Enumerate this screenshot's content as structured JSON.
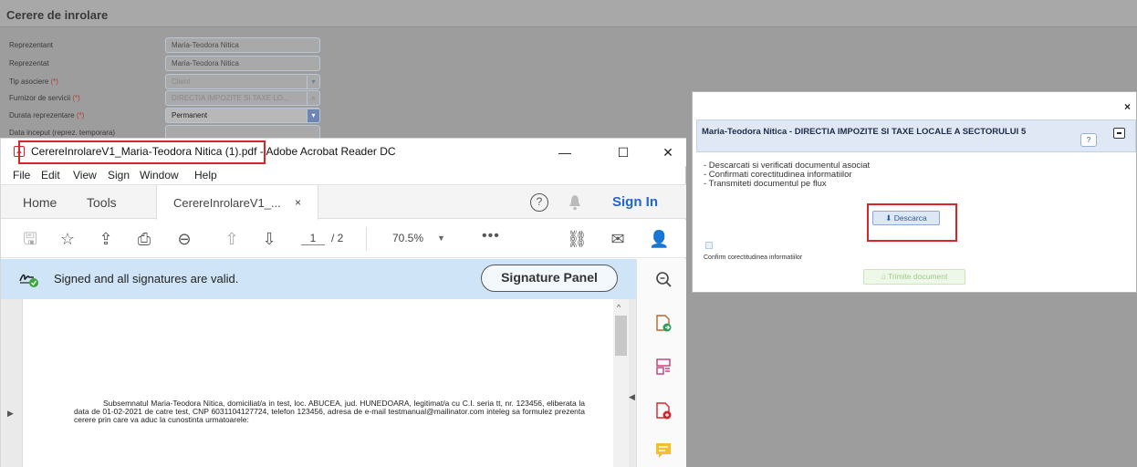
{
  "form": {
    "title": "Cerere de inrolare",
    "rows": [
      {
        "label": "Reprezentant",
        "req": "",
        "value": "Maria-Teodora Nitica",
        "disabled": false
      },
      {
        "label": "Reprezentat",
        "req": "",
        "value": "Maria-Teodora Nitica",
        "disabled": false
      },
      {
        "label": "Tip asociere",
        "req": "(*)",
        "value": "Client",
        "disabled": true
      },
      {
        "label": "Furnizor de servicii",
        "req": "(*)",
        "value": "DIRECTIA IMPOZITE SI TAXE LO...",
        "disabled": true
      },
      {
        "label": "Durata reprezentare",
        "req": "(*)",
        "value": "Permanent",
        "disabled": false
      },
      {
        "label": "Data inceput (reprez. temporara)",
        "req": "",
        "value": "",
        "disabled": false
      }
    ]
  },
  "dialog": {
    "close": "×",
    "panel_title": "Maria-Teodora Nitica - DIRECTIA IMPOZITE SI TAXE LOCALE A SECTORULUI 5",
    "help": "?",
    "steps": [
      "- Descarcati si verificati documentul asociat",
      "- Confirmati corectitudinea informatiilor",
      "- Transmiteti documentul pe flux"
    ],
    "download_label": "Descarca",
    "confirm_label": "Confirm corectitudinea informatiilor",
    "send_label": "Trimite document"
  },
  "acrobat": {
    "window_title": "CerereInrolareV1_Maria-Teodora Nitica (1).pdf - Adobe Acrobat Reader DC",
    "menu": [
      "File",
      "Edit",
      "View",
      "Sign",
      "Window",
      "Help"
    ],
    "tabs": {
      "home": "Home",
      "tools": "Tools",
      "doc": "CerereInrolareV1_...",
      "doc_close": "×"
    },
    "sign_in": "Sign In",
    "page_current": "1",
    "page_total": "/ 2",
    "zoom": "70.5%",
    "signature_status": "Signed and all signatures are valid.",
    "signature_panel": "Signature Panel",
    "document_text": "Subsemnatul Maria-Teodora Nitica, domiciliat/a in test, loc. ABUCEA, jud. HUNEDOARA, legitimat/a cu C.I. seria tt, nr. 123456, eliberata la data de 01-02-2021 de catre test, CNP 6031104127724, telefon 123456, adresa de e-mail testmanual@mailinator.com inteleg sa formulez prezenta cerere prin care va aduc la cunostinta urmatoarele:"
  },
  "colors": {
    "highlight": "#d9262a",
    "acrobat_red": "#d1262b",
    "sign_in": "#2166c9",
    "signature_bar": "#cfe5f7"
  }
}
